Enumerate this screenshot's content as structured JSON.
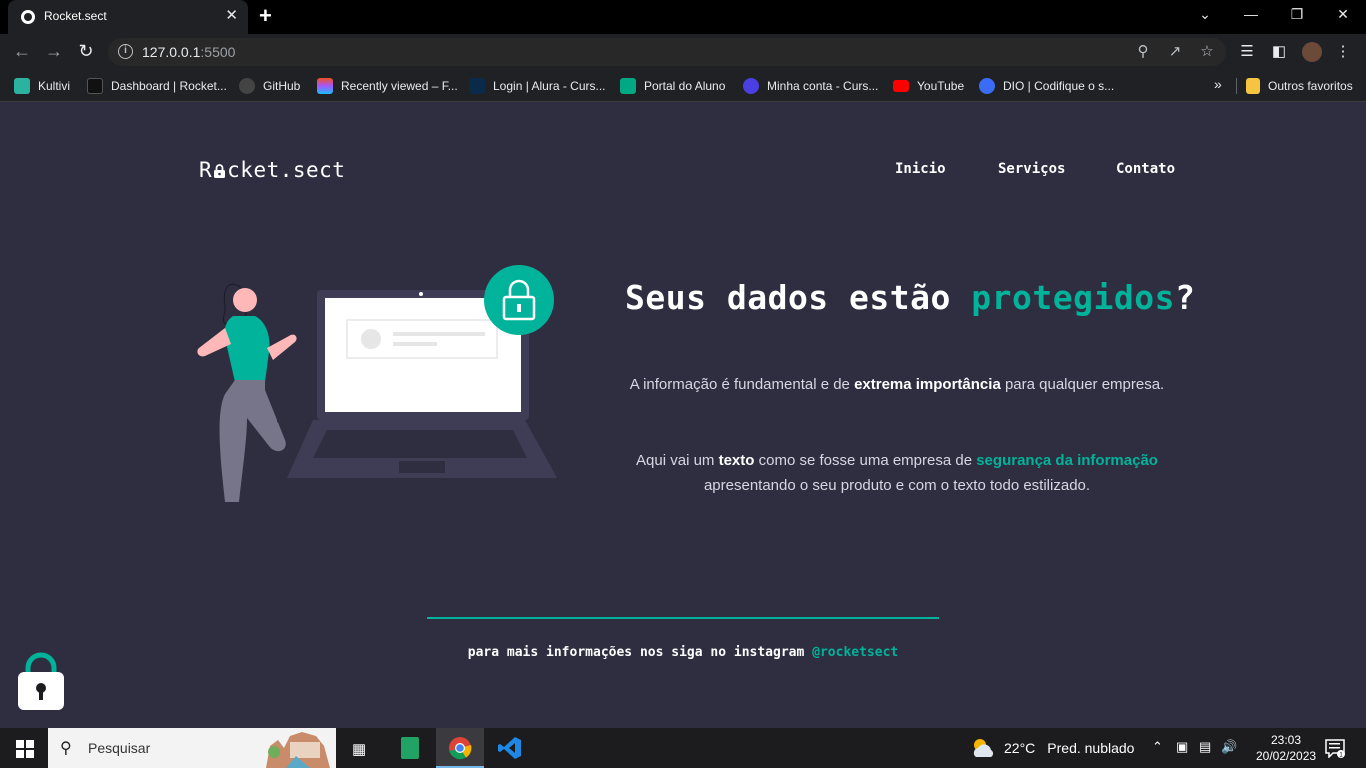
{
  "browser": {
    "tab_title": "Rocket.sect",
    "tab_close": "✕",
    "new_tab": "+",
    "url_host": "127.0.0.1",
    "url_port": ":5500",
    "bookmarks": [
      {
        "label": "Kultivi",
        "color": "#2bb3a0"
      },
      {
        "label": "Dashboard | Rocket...",
        "color": "#111111"
      },
      {
        "label": "GitHub",
        "color": "#333333"
      },
      {
        "label": "Recently viewed – F...",
        "color": "#f24e1e"
      },
      {
        "label": "Login | Alura - Curs...",
        "color": "#0b2a4a"
      },
      {
        "label": "Portal do Aluno",
        "color": "#00a884"
      },
      {
        "label": "Minha conta - Curs...",
        "color": "#4a3fe0"
      },
      {
        "label": "YouTube",
        "color": "#ff0000"
      },
      {
        "label": "DIO | Codifique o s...",
        "color": "#3b6cf6"
      },
      {
        "label": "Outros favoritos",
        "color": "#f5c542"
      }
    ],
    "bookmarks_more": "»"
  },
  "site": {
    "logo": {
      "before": "R",
      "after": "cket.sect"
    },
    "nav": [
      "Inicio",
      "Serviços",
      "Contato"
    ],
    "hero": {
      "title_start": "Seus dados estão ",
      "title_accent": "protegidos",
      "title_end": "?",
      "p1": {
        "a": "A informação é fundamental e de ",
        "b": "extrema importância",
        "c": " para qualquer empresa."
      },
      "p2": {
        "a": "Aqui vai um ",
        "b": "texto",
        "c": " como se fosse uma empresa de ",
        "d": "segurança da informação",
        "e": " apresentando o seu produto e com o texto todo estilizado."
      }
    },
    "footer": {
      "text": "para mais informações nos siga no instagram ",
      "handle": "@rocketsect"
    },
    "colors": {
      "accent": "#00b39a",
      "background": "#2f2e41"
    }
  },
  "taskbar": {
    "search_placeholder": "Pesquisar",
    "weather_temp": "22°C",
    "weather_desc": "Pred. nublado",
    "time": "23:03",
    "date": "20/02/2023"
  }
}
